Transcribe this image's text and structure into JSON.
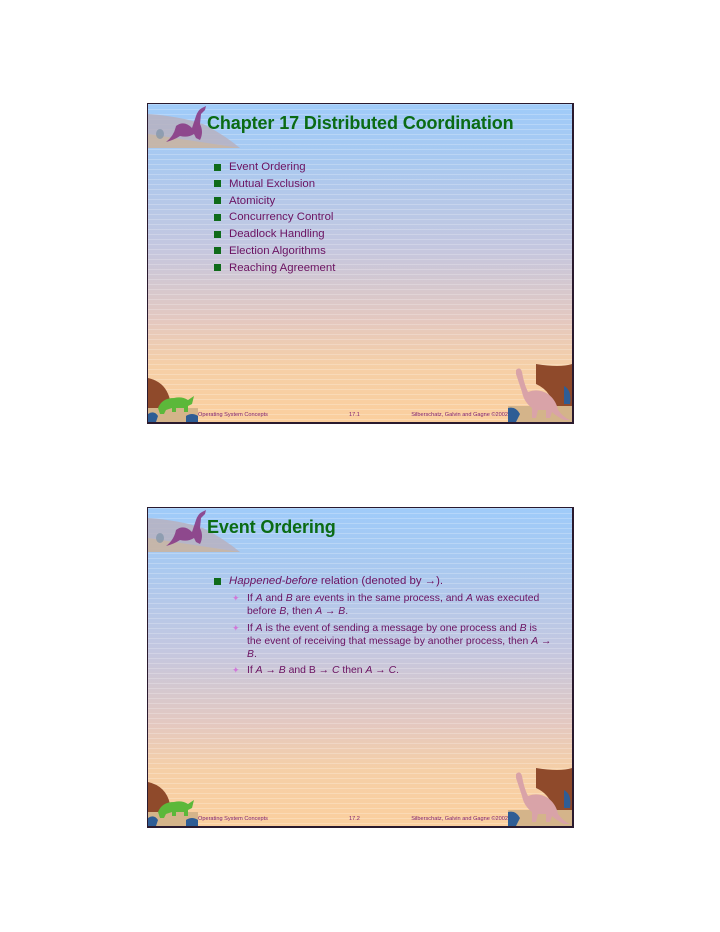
{
  "slides": [
    {
      "title": "Chapter 17  Distributed Coordination",
      "bullets": [
        "Event Ordering",
        "Mutual Exclusion",
        "Atomicity",
        "Concurrency Control",
        "Deadlock Handling",
        "Election Algorithms",
        "Reaching Agreement"
      ],
      "footer": {
        "left": "Operating System Concepts",
        "center": "17.1",
        "right": "Silberschatz, Galvin and  Gagne ©2002"
      }
    },
    {
      "title": "Event Ordering",
      "main_bullet": {
        "italic": "Happened-before",
        "rest": " relation (denoted by →)."
      },
      "sub_bullets": [
        [
          "If ",
          {
            "i": "A"
          },
          " and ",
          {
            "i": "B"
          },
          " are events in the same process, and ",
          {
            "i": "A"
          },
          " was executed before ",
          {
            "i": "B"
          },
          ", then ",
          {
            "i": "A"
          },
          " → ",
          {
            "i": "B"
          },
          "."
        ],
        [
          "If ",
          {
            "i": "A"
          },
          " is the event of sending a message by one process and ",
          {
            "i": "B"
          },
          " is the event of receiving that message by another process, then ",
          {
            "i": "A"
          },
          " → ",
          {
            "i": "B"
          },
          "."
        ],
        [
          "If ",
          {
            "i": "A"
          },
          " → ",
          {
            "i": "B"
          },
          " and B → ",
          {
            "i": "C"
          },
          " then ",
          {
            "i": "A"
          },
          " → ",
          {
            "i": "C"
          },
          "."
        ]
      ],
      "footer": {
        "left": "Operating System Concepts",
        "center": "17.2",
        "right": "Silberschatz, Galvin and  Gagne ©2002"
      }
    }
  ],
  "icons": {
    "header_art": "dinosaur-silhouette-icon",
    "footer_left_art": "triceratops-icon",
    "footer_right_art": "brontosaurus-icon",
    "bullet_level1": "green-square-bullet",
    "bullet_level2": "diamond-bullet"
  },
  "colors": {
    "title": "#0b6b14",
    "text": "#6b1261",
    "bullet_square": "#0f6b1a",
    "bullet_diamond": "#d078d8",
    "bg_top": "#9fcbf9",
    "bg_bottom": "#fbcf9e"
  }
}
